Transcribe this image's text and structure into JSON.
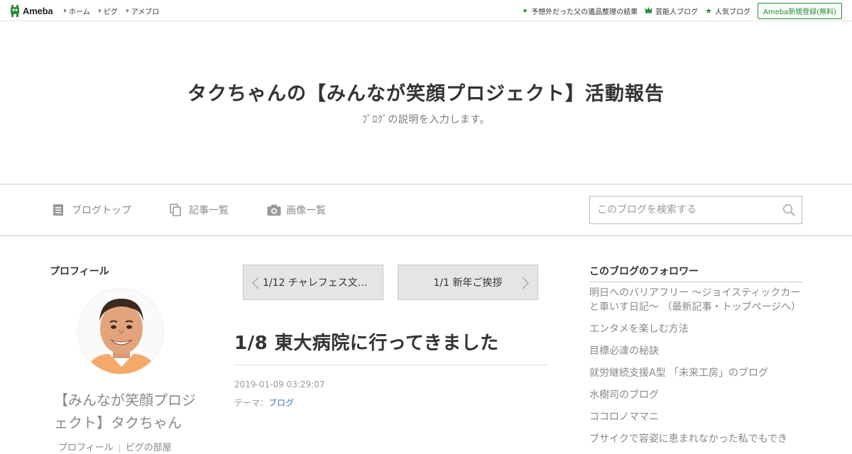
{
  "topbar": {
    "logo_text": "Ameba",
    "nav": [
      {
        "label": "ホーム"
      },
      {
        "label": "ピグ"
      },
      {
        "label": "アメブロ"
      }
    ],
    "right_links": [
      {
        "label": "予想外だった父の遺品整理の結果",
        "icon": "sparkle-icon"
      },
      {
        "label": "芸能人ブログ",
        "icon": "crown-icon"
      },
      {
        "label": "人気ブログ",
        "icon": "star-icon"
      }
    ],
    "register_label": "Ameba新規登録(無料)"
  },
  "header": {
    "title": "タクちゃんの【みんなが笑顔プロジェクト】活動報告",
    "description": "ﾌﾞﾛｸﾞの説明を入力します。"
  },
  "blog_nav": {
    "items": [
      {
        "label": "ブログトップ",
        "icon": "document-icon"
      },
      {
        "label": "記事一覧",
        "icon": "copy-icon"
      },
      {
        "label": "画像一覧",
        "icon": "camera-icon"
      }
    ],
    "search_placeholder": "このブログを検索する"
  },
  "profile": {
    "heading": "プロフィール",
    "name": "【みんなが笑顔プロジェクト】タクちゃん",
    "links": [
      "プロフィール",
      "ピグの部屋"
    ]
  },
  "entry": {
    "prev_label": "1/12 チャレフェス文…",
    "next_label": "1/1 新年ご挨拶",
    "title": "1/8 東大病院に行ってきました",
    "date": "2019-01-09 03:29:07",
    "theme_prefix": "テーマ：",
    "theme": "ブログ"
  },
  "followers": {
    "heading": "このブログのフォロワー",
    "items": [
      "明日へのバリアフリー ～ジョイスティックカーと車いす日記～ （最新記事・トップページへ）",
      "エンタメを楽しむ方法",
      "目標必達の秘訣",
      "就労継続支援A型 「未来工房」のブログ",
      "水樹司のブログ",
      "ココロノママニ",
      "ブサイクで容姿に恵まれなかった私でもでき"
    ]
  },
  "colors": {
    "brand_green": "#2d8c3c",
    "link_blue": "#3a78b8"
  }
}
